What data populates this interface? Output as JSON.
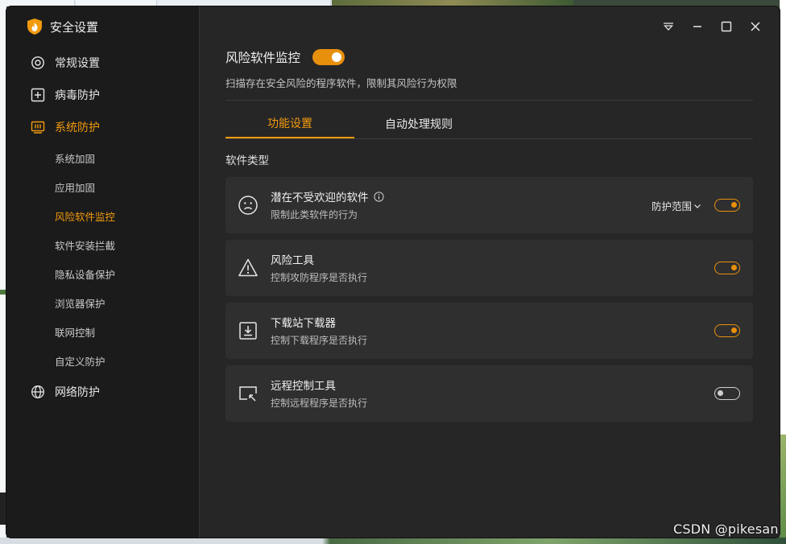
{
  "app": {
    "title": "安全设置",
    "accent_color": "#f29a0d"
  },
  "sidebar": {
    "items": [
      {
        "label": "常规设置",
        "icon": "settings-icon"
      },
      {
        "label": "病毒防护",
        "icon": "plus-square-icon"
      },
      {
        "label": "系统防护",
        "icon": "system-chip-icon",
        "active": true
      },
      {
        "label": "网络防护",
        "icon": "globe-icon"
      }
    ],
    "sub_items": [
      {
        "label": "系统加固"
      },
      {
        "label": "应用加固"
      },
      {
        "label": "风险软件监控",
        "active": true
      },
      {
        "label": "软件安装拦截"
      },
      {
        "label": "隐私设备保护"
      },
      {
        "label": "浏览器保护"
      },
      {
        "label": "联网控制"
      },
      {
        "label": "自定义防护"
      }
    ]
  },
  "window_controls": [
    "dropdown-menu-icon",
    "minimize-icon",
    "maximize-icon",
    "close-icon"
  ],
  "main": {
    "title": "风险软件监控",
    "title_toggle_on": true,
    "subtitle": "扫描存在安全风险的程序软件，限制其风险行为权限",
    "tabs": [
      {
        "label": "功能设置",
        "active": true
      },
      {
        "label": "自动处理规则",
        "active": false
      }
    ],
    "section_label": "软件类型",
    "cards": [
      {
        "title": "潜在不受欢迎的软件",
        "desc": "限制此类软件的行为",
        "icon": "sad-face-icon",
        "enabled": true,
        "scope_label": "防护范围"
      },
      {
        "title": "风险工具",
        "desc": "控制攻防程序是否执行",
        "icon": "warning-triangle-icon",
        "enabled": true
      },
      {
        "title": "下载站下载器",
        "desc": "控制下载程序是否执行",
        "icon": "download-icon",
        "enabled": true
      },
      {
        "title": "远程控制工具",
        "desc": "控制远程程序是否执行",
        "icon": "remote-screen-icon",
        "enabled": false
      }
    ]
  },
  "watermark": "CSDN @pikesan"
}
